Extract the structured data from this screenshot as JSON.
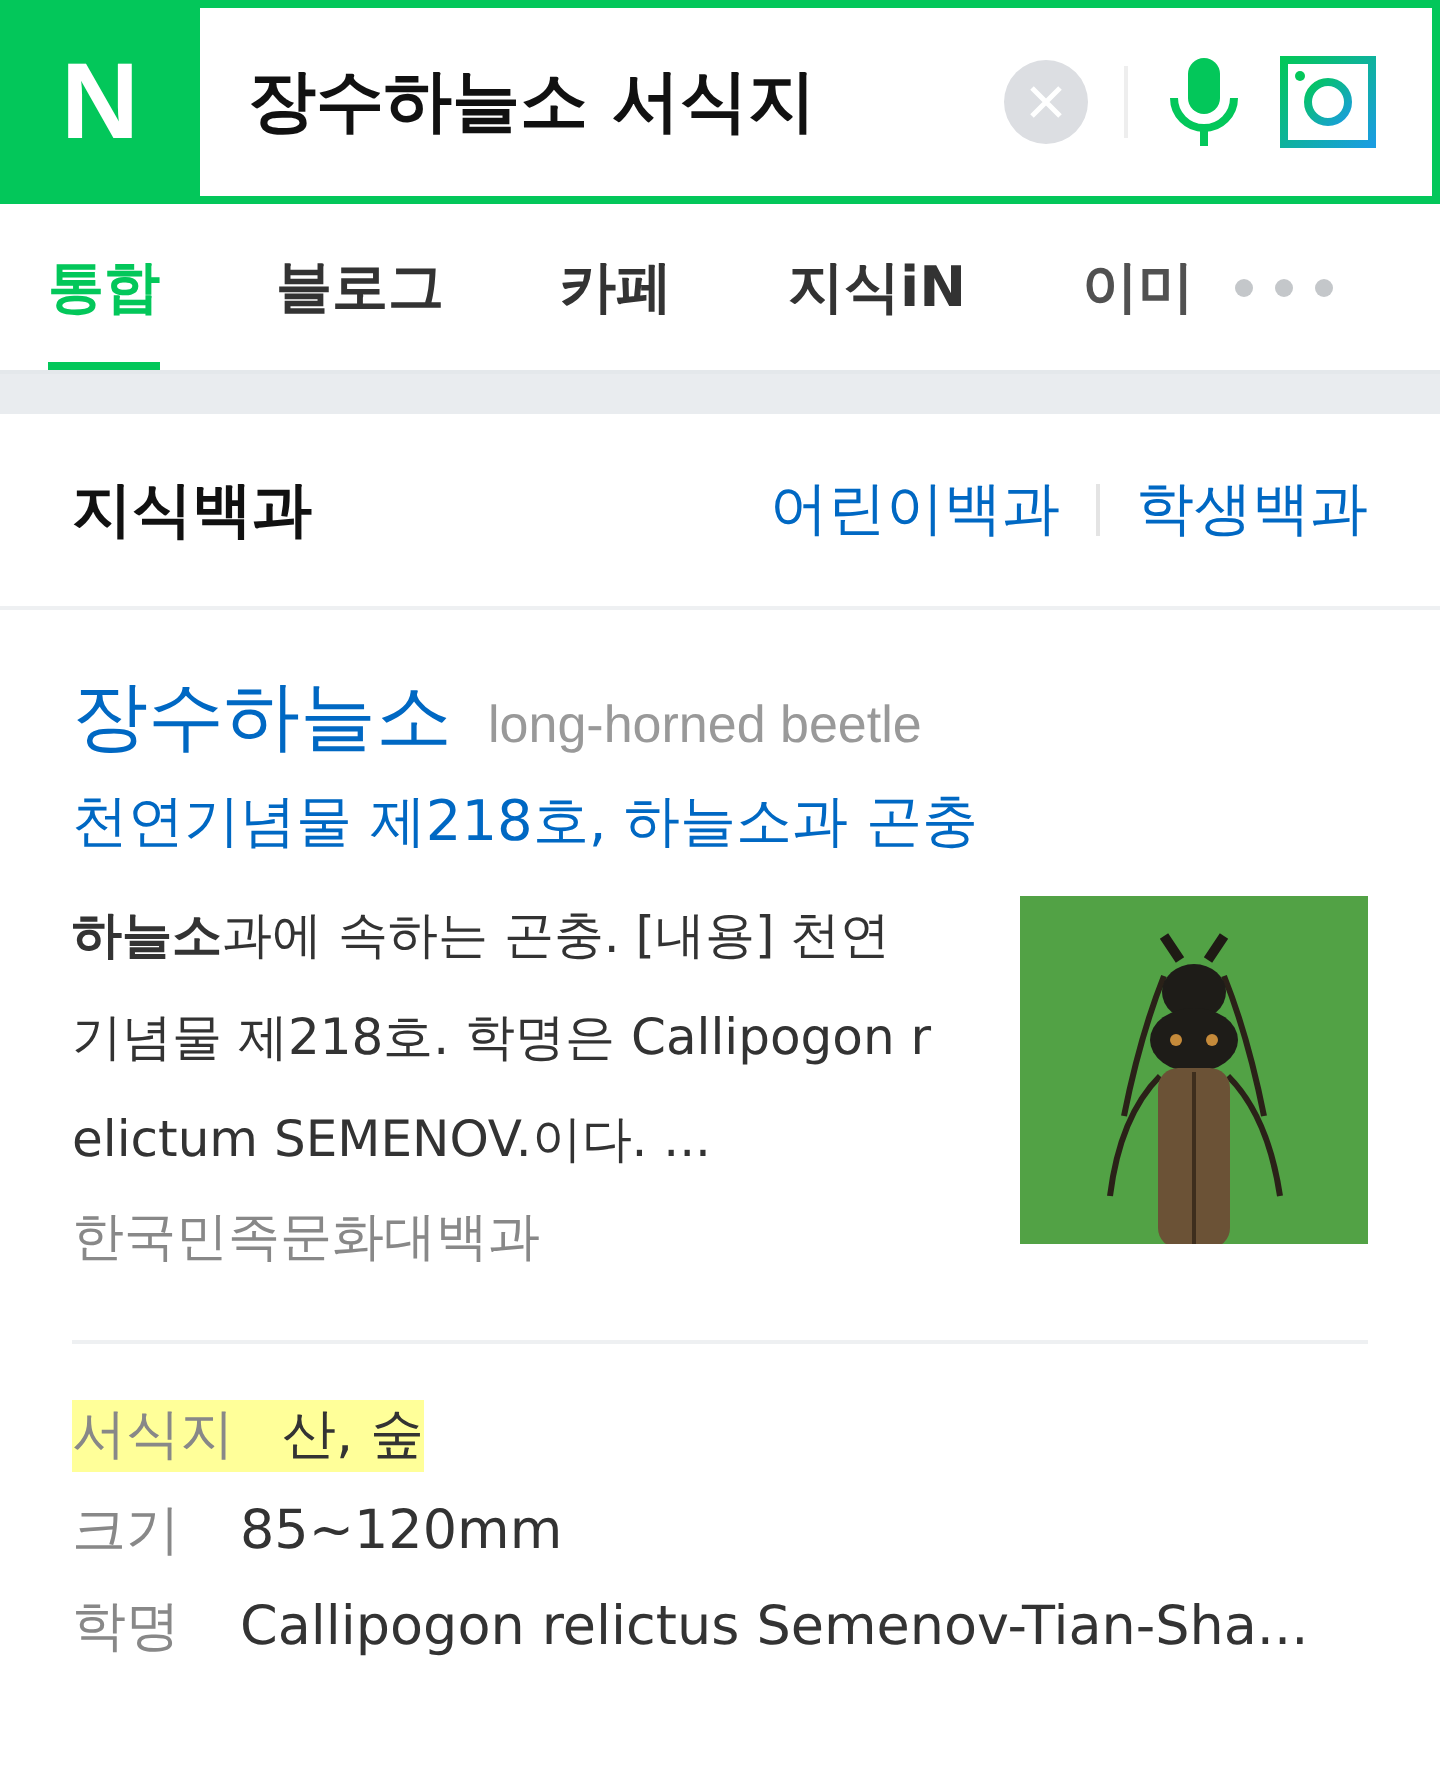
{
  "header": {
    "logo": "N",
    "query": "장수하늘소 서식지"
  },
  "tabs": [
    {
      "label": "통합",
      "selected": true
    },
    {
      "label": "블로그",
      "selected": false
    },
    {
      "label": "카페",
      "selected": false
    },
    {
      "label": "지식iN",
      "selected": false
    },
    {
      "label": "이미",
      "selected": false
    }
  ],
  "section": {
    "title": "지식백과",
    "links": [
      "어린이백과",
      "학생백과"
    ]
  },
  "entry": {
    "title": "장수하늘소",
    "subtitle": "long-horned beetle",
    "category": "천연기념물 제218호, 하늘소과 곤충",
    "summary": "**하늘소**과에 속하는 곤충. [내용] 천연기념물 제218호. 학명은 Callipogon relictum SEMENOV.이다. ...",
    "source": "한국민족문화대백과"
  },
  "facts": [
    {
      "label": "서식지",
      "value": "산, 숲",
      "highlighted": true
    },
    {
      "label": "크기",
      "value": "85~120mm",
      "highlighted": false
    },
    {
      "label": "학명",
      "value": "Callipogon relictus Semenov-Tian-Sha...",
      "highlighted": false
    }
  ]
}
